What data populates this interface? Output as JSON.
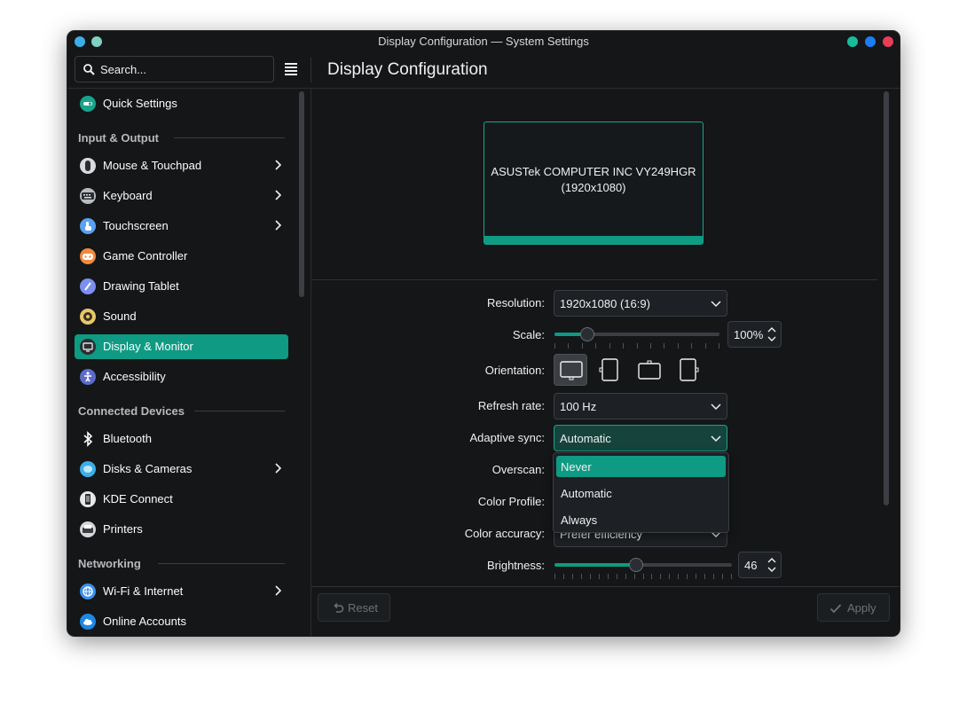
{
  "window": {
    "title": "Display Configuration — System Settings"
  },
  "search": {
    "placeholder": "Search..."
  },
  "page": {
    "title": "Display Configuration"
  },
  "sidebar": {
    "quick_settings": "Quick Settings",
    "sections": [
      {
        "title": "Input & Output"
      },
      {
        "title": "Connected Devices"
      },
      {
        "title": "Networking"
      }
    ],
    "items": [
      {
        "label": "Mouse & Touchpad",
        "icon": "mouse-icon"
      },
      {
        "label": "Keyboard",
        "icon": "keyboard-icon"
      },
      {
        "label": "Touchscreen",
        "icon": "touchscreen-icon"
      },
      {
        "label": "Game Controller",
        "icon": "game-controller-icon"
      },
      {
        "label": "Drawing Tablet",
        "icon": "drawing-tablet-icon"
      },
      {
        "label": "Sound",
        "icon": "sound-icon"
      },
      {
        "label": "Display & Monitor",
        "icon": "display-icon",
        "active": true
      },
      {
        "label": "Accessibility",
        "icon": "accessibility-icon"
      },
      {
        "label": "Bluetooth",
        "icon": "bluetooth-icon"
      },
      {
        "label": "Disks & Cameras",
        "icon": "disks-icon"
      },
      {
        "label": "KDE Connect",
        "icon": "kde-connect-icon"
      },
      {
        "label": "Printers",
        "icon": "printer-icon"
      },
      {
        "label": "Wi-Fi & Internet",
        "icon": "wifi-icon"
      },
      {
        "label": "Online Accounts",
        "icon": "cloud-icon"
      }
    ]
  },
  "monitor": {
    "name": "ASUSTek COMPUTER INC VY249HGR",
    "resolution_label": "(1920x1080)"
  },
  "settings": {
    "resolution": {
      "label": "Resolution:",
      "value": "1920x1080 (16:9)"
    },
    "scale": {
      "label": "Scale:",
      "value": "100%",
      "level": 0.2
    },
    "orientation": {
      "label": "Orientation:",
      "selected": "landscape"
    },
    "refresh_rate": {
      "label": "Refresh rate:",
      "value": "100 Hz"
    },
    "adaptive_sync": {
      "label": "Adaptive sync:",
      "value": "Automatic",
      "options": [
        "Never",
        "Automatic",
        "Always"
      ],
      "highlighted": "Never"
    },
    "overscan": {
      "label": "Overscan:"
    },
    "color_profile": {
      "label": "Color Profile:"
    },
    "color_accuracy": {
      "label": "Color accuracy:",
      "value": "Prefer efficiency"
    },
    "brightness": {
      "label": "Brightness:",
      "value": "46",
      "level": 0.46
    }
  },
  "footer": {
    "reset_label": "Reset",
    "apply_label": "Apply"
  },
  "colors": {
    "accent": "#0e9a83",
    "background": "#141618",
    "text": "#fcfcfc",
    "close": "#e93d58",
    "maximize": "#1b7ef5",
    "minimize": "#1abc9c"
  }
}
